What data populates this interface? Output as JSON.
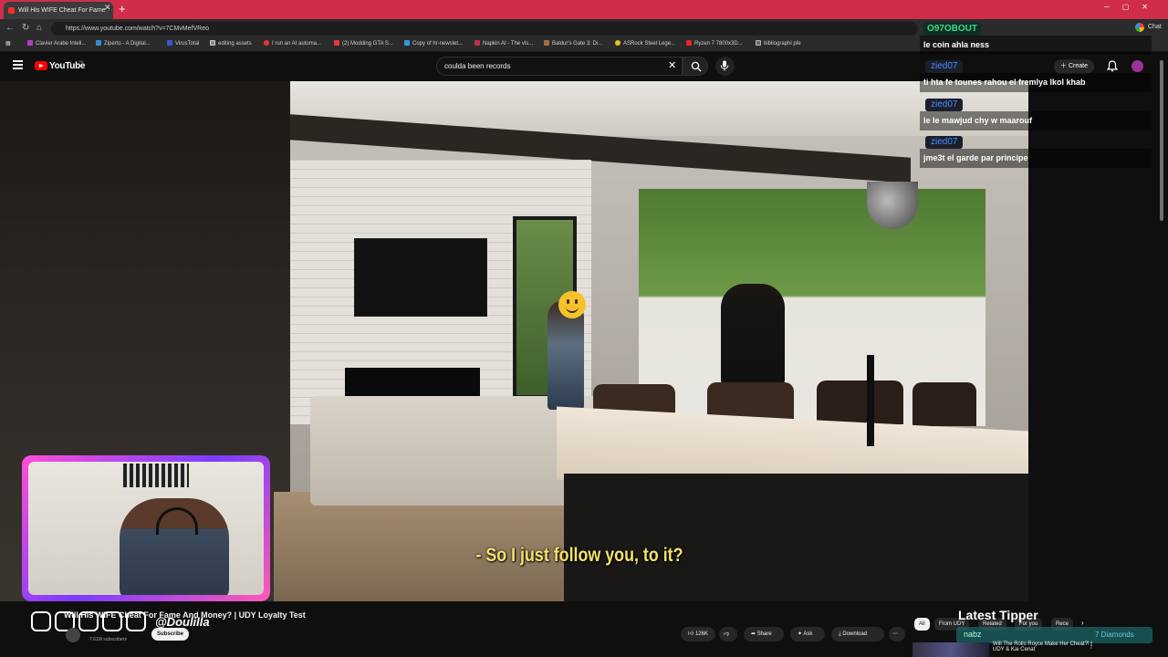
{
  "browser": {
    "tab_title": "Will His WIFE Cheat For Fame",
    "url": "https://www.youtube.com/watch?v=7CMvMefVReo",
    "bookmarks": [
      "Clavier Arabe Intell...",
      "Ziperto - A Digital...",
      "VirusTotal",
      "editing assets",
      "I run an AI automa...",
      "(2) Modding GTA S...",
      "Copy of hr-newslet...",
      "Napkin AI - The vis...",
      "Baldur's Gate 3: Di...",
      "ASRock Steel Lege...",
      "Ryzen 7 7800x3D...",
      "bibliographi pfe"
    ],
    "chat_label": "Chat"
  },
  "youtube": {
    "logo_text": "YouTube",
    "logo_region": "TN",
    "search_value": "coulda been records",
    "create_label": "Create"
  },
  "video": {
    "subtitle": "- So I just follow you, to it?",
    "title": "Will His WIFE Cheat For Fame And Money? | UDY Loyalty Test",
    "subscribers": "7.61M subscribers",
    "subscribe_label": "Subscribe",
    "likes": "126K",
    "share_label": "Share",
    "ask_label": "Ask",
    "download_label": "Download"
  },
  "overlay": {
    "social_handle": "@Doulilla",
    "chat": [
      {
        "user": "O97OBOUT",
        "message": "le coin ahla ness"
      },
      {
        "user": "zied07",
        "message": "ti hta fe tounes rahou el fremlya lkol khab"
      },
      {
        "user": "zied07",
        "message": "le le mawjud chy w maarouf"
      },
      {
        "user": "zied07",
        "message": "jme3t el garde par principe"
      }
    ],
    "latest_tipper_label": "Latest Tipper",
    "tipper_name": "nabz",
    "tipper_amount": "7 Diamonds"
  },
  "sidebar": {
    "chips": [
      "All",
      "From UDY",
      "Related",
      "For you",
      "Rece"
    ],
    "rec_video_title": "Will The Rolls Royce Make Her Cheat?! | UDY & Kai Cenat"
  }
}
